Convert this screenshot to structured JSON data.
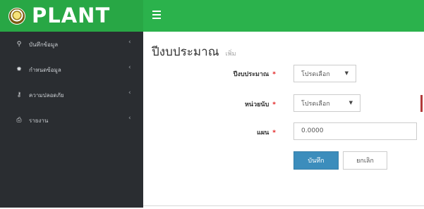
{
  "brand": {
    "name": "PLANT"
  },
  "colors": {
    "brand_bg": "#28a745",
    "topbar_bg": "#2bb24c",
    "sidebar_bg": "#2a2d31",
    "primary": "#3c8dbc",
    "required": "#e11d1d"
  },
  "sidebar": {
    "items": [
      {
        "label": "บันทึกข้อมูล",
        "icon": "thumbtack-icon"
      },
      {
        "label": "กำหนดข้อมูล",
        "icon": "gear-icon"
      },
      {
        "label": "ความปลอดภัย",
        "icon": "key-icon"
      },
      {
        "label": "รายงาน",
        "icon": "printer-icon"
      }
    ]
  },
  "page": {
    "title": "ปีงบประมาณ",
    "subtitle": "เพิ่ม"
  },
  "form": {
    "fiscal_year": {
      "label": "ปีงบประมาณ",
      "value": "โปรดเลือก"
    },
    "unit": {
      "label": "หน่วยนับ",
      "value": "โปรดเลือก"
    },
    "plan": {
      "label": "แผน",
      "value": "0.0000"
    },
    "required_mark": "*",
    "save_label": "บันทึก",
    "cancel_label": "ยกเลิก"
  }
}
